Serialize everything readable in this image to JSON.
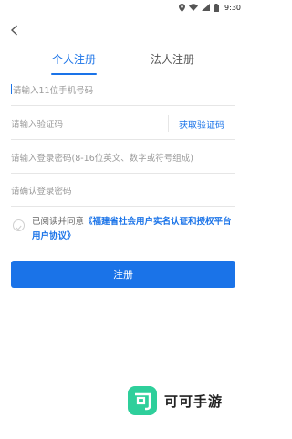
{
  "status_bar": {
    "time": "9:30"
  },
  "tabs": [
    {
      "label": "个人注册",
      "active": true
    },
    {
      "label": "法人注册",
      "active": false
    }
  ],
  "form": {
    "phone_placeholder": "请输入11位手机号码",
    "code_placeholder": "请输入验证码",
    "get_code_label": "获取验证码",
    "password_placeholder": "请输入登录密码(8-16位英文、数字或符号组成)",
    "confirm_password_placeholder": "请确认登录密码"
  },
  "agreement": {
    "prefix": "已阅读并同意",
    "link": "《福建省社会用户实名认证和授权平台用户协议》",
    "checked": false
  },
  "register_label": "注册",
  "brand": {
    "logo_glyph": "可",
    "name": "可可手游"
  },
  "colors": {
    "accent": "#1a73e8",
    "brand": "#2ecf9b"
  },
  "icons": [
    "location-icon",
    "wifi-icon",
    "signal-icon",
    "battery-icon",
    "back-arrow-icon",
    "check-icon"
  ]
}
